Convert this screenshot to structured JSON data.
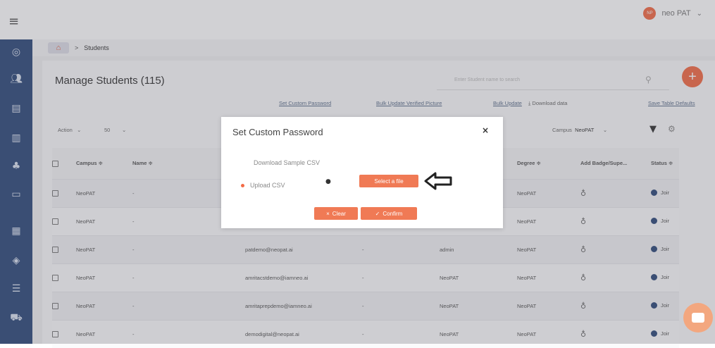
{
  "header": {
    "menu_icon": "hamburger-icon",
    "avatar_initials": "NP",
    "user_name": "neo PAT",
    "dropdown_icon": "chevron-down-icon"
  },
  "sidebar": {
    "icons": [
      "dashboard-icon",
      "users-icon",
      "document-icon",
      "file-icon",
      "org-chart-icon",
      "message-icon",
      "building-icon",
      "shield-icon",
      "notes-icon",
      "cart-icon"
    ]
  },
  "breadcrumb": {
    "home_icon": "home-icon",
    "separator": ">",
    "current": "Students"
  },
  "page": {
    "title": "Manage Students (115)",
    "search_placeholder": "Enter Student name to search",
    "add_label": "+"
  },
  "toolbar_links": {
    "set_custom_password": "Set Custom Password",
    "bulk_update_verified_picture": "Bulk Update Verified Picture",
    "bulk_update": "Bulk Update",
    "download_data": "Download data",
    "save_table_defaults": "Save Table Defaults"
  },
  "filters": {
    "action": "Action",
    "page_size": "50",
    "campus_label": "Campus",
    "campus_value": "NeoPAT"
  },
  "table": {
    "headers": [
      "Campus ≑",
      "Name ≑",
      "Degree ≑",
      "Add Badge/Supe...",
      "Status ≑"
    ],
    "rows": [
      {
        "campus": "NeoPAT",
        "name": "-",
        "email": "",
        "col4": "",
        "col5": "",
        "degree": "NeoPAT",
        "status": "Joir"
      },
      {
        "campus": "NeoPAT",
        "name": "-",
        "email": "",
        "col4": "",
        "col5": "",
        "degree": "NeoPAT",
        "status": "Joir"
      },
      {
        "campus": "NeoPAT",
        "name": "-",
        "email": "patdemo@neopat.ai",
        "col4": "-",
        "col5": "admin",
        "degree": "NeoPAT",
        "status": "Joir"
      },
      {
        "campus": "NeoPAT",
        "name": "-",
        "email": "amritacstdemo@iamneo.ai",
        "col4": "-",
        "col5": "NeoPAT",
        "degree": "NeoPAT",
        "status": "Joir"
      },
      {
        "campus": "NeoPAT",
        "name": "-",
        "email": "amritaprepdemo@iamneo.ai",
        "col4": "-",
        "col5": "NeoPAT",
        "degree": "NeoPAT",
        "status": "Joir"
      },
      {
        "campus": "NeoPAT",
        "name": "-",
        "email": "demodigital@neopat.ai",
        "col4": "-",
        "col5": "NeoPAT",
        "degree": "NeoPAT",
        "status": "Joir"
      }
    ]
  },
  "modal": {
    "title": "Set Custom Password",
    "close": "×",
    "download_sample": "Download Sample CSV",
    "upload_csv": "Upload CSV",
    "select_file": "Select a file",
    "clear": "Clear",
    "confirm": "Confirm"
  },
  "colors": {
    "sidebar": "#2f4a7a",
    "accent": "#f36b46",
    "button": "#f07a55"
  }
}
